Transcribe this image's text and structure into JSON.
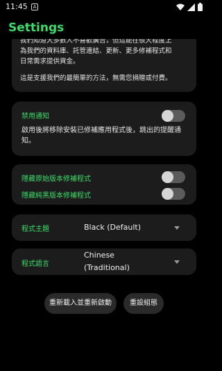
{
  "status_bar": {
    "time": "11:45",
    "notification_letter": "A",
    "icons": [
      "wifi-icon",
      "signal-icon",
      "battery-icon"
    ]
  },
  "header": {
    "title": "Settings"
  },
  "intro_card": {
    "line1": "我們知道大多數人不喜歡廣告，但這能在很大程度上",
    "line2": "為我們的資料庫、託管連結、更新、更多修補程式和",
    "line3": "日常需求提供資金。",
    "line4": "這是支援我們的最簡單的方法，無需您捐贈或付費。"
  },
  "notifications_card": {
    "label": "禁用通知",
    "description": "啟用後將移除安裝已修補應用程式後，跳出的提醒通知。",
    "toggle_on": false
  },
  "hide_card": {
    "hide_original_label": "隱藏原始版本修補程式",
    "hide_original_on": false,
    "hide_black_label": "隱藏純黑版本修補程式",
    "hide_black_on": false
  },
  "theme_select": {
    "label": "程式主題",
    "value": "Black (Default)"
  },
  "language_select": {
    "label": "程式語言",
    "value_line1": "Chinese",
    "value_line2": "(Traditional)"
  },
  "actions": {
    "reload_label": "重新載入並重新啟動",
    "reset_label": "重設組態"
  },
  "colors": {
    "accent": "#3ddc6a",
    "background": "#000000",
    "card": "#1c1c1c",
    "button": "#2a2a2a"
  }
}
